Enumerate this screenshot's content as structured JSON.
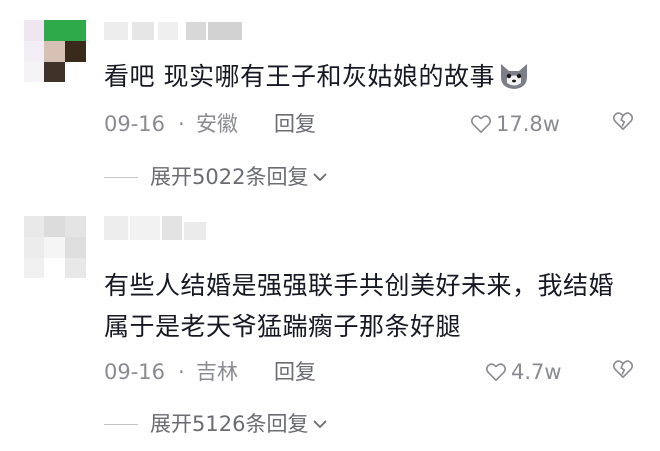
{
  "comments": [
    {
      "text": "看吧 现实哪有王子和灰姑娘的故事",
      "emoji_icon": "wolf-face-emoji",
      "date": "09-16",
      "separator": "·",
      "location": "安徽",
      "reply_label": "回复",
      "likes": "17.8w",
      "expand_label": "展开5022条回复"
    },
    {
      "text": "有些人结婚是强强联手共创美好未来，我结婚属于是老天爷猛踹瘸子那条好腿",
      "date": "09-16",
      "separator": "·",
      "location": "吉林",
      "reply_label": "回复",
      "likes": "4.7w",
      "expand_label": "展开5126条回复"
    }
  ],
  "colors": {
    "text_primary": "#161823",
    "text_secondary": "#8a8b91",
    "avatar1_green": "#2faa4a",
    "avatar1_dark": "#3a2a1c"
  },
  "icons": [
    "heart-outline-icon",
    "broken-heart-icon",
    "chevron-down-icon"
  ]
}
